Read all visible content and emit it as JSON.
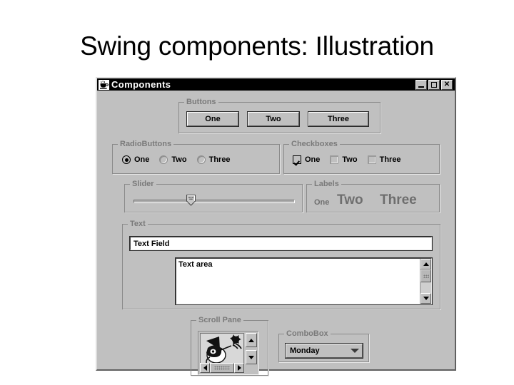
{
  "slide": {
    "title": "Swing components: Illustration"
  },
  "window": {
    "title": "Components",
    "icon": "java-coffee-cup-icon",
    "minimize_label": "_",
    "maximize_label": "□",
    "close_label": "✕"
  },
  "groups": {
    "buttons": {
      "title": "Buttons",
      "items": [
        {
          "label": "One"
        },
        {
          "label": "Two"
        },
        {
          "label": "Three"
        }
      ]
    },
    "radiobuttons": {
      "title": "RadioButtons",
      "items": [
        {
          "label": "One",
          "selected": true
        },
        {
          "label": "Two",
          "selected": false
        },
        {
          "label": "Three",
          "selected": false
        }
      ]
    },
    "checkboxes": {
      "title": "Checkboxes",
      "items": [
        {
          "label": "One",
          "checked": true
        },
        {
          "label": "Two",
          "checked": false
        },
        {
          "label": "Three",
          "checked": false
        }
      ]
    },
    "slider": {
      "title": "Slider",
      "value_percent": 33
    },
    "labels": {
      "title": "Labels",
      "items": [
        {
          "label": "One",
          "size": "small"
        },
        {
          "label": "Two",
          "size": "medium"
        },
        {
          "label": "Three",
          "size": "large"
        }
      ]
    },
    "text": {
      "title": "Text",
      "textfield_value": "Text Field",
      "textarea_value": "Text area"
    },
    "scrollpane": {
      "title": "Scroll Pane",
      "image_alt": "bird-graphic"
    },
    "combobox": {
      "title": "ComboBox",
      "selected": "Monday"
    }
  },
  "colors": {
    "window_background": "#c0c0c0",
    "titlebar_background": "#000000",
    "titlebar_text": "#ffffff",
    "group_title_text": "#7a7a7a",
    "label_text": "#6e6e6e",
    "field_background": "#ffffff",
    "page_background": "#ffffff"
  }
}
